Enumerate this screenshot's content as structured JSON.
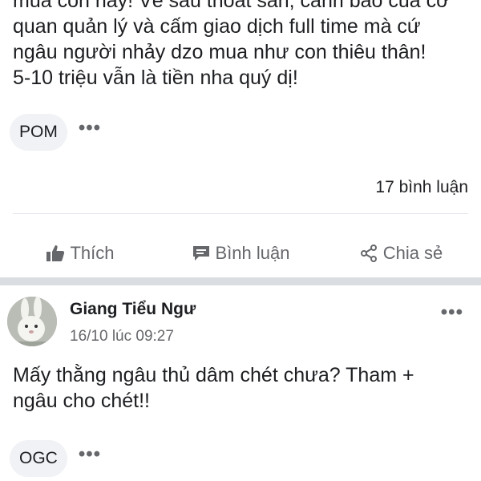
{
  "post1": {
    "text": "mua con này! Về sau thoát sàn, cảnh báo của cơ\nquan quản lý và cấm giao dịch full time mà cứ\nngâu người nhảy dzo mua như con thiêu thân!\n5-10 triệu vẫn là tiền nha quý dị!",
    "tag": "POM",
    "more": "•••",
    "comment_count": "17 bình luận"
  },
  "actions": {
    "like": "Thích",
    "comment": "Bình luận",
    "share": "Chia sẻ"
  },
  "post2": {
    "author": "Giang Tiểu Ngư",
    "time": "16/10 lúc 09:27",
    "text": "Mấy thằng ngâu thủ dâm chét chưa? Tham +\nngâu cho chét!!",
    "tag": "OGC",
    "more": "•••",
    "options": "•••"
  },
  "icons": {
    "like": "thumbs-up-icon",
    "comment": "comment-bubble-icon",
    "share": "share-icon",
    "more": "more-dots-icon"
  },
  "colors": {
    "text": "#1c1e21",
    "secondary_text": "#65676b",
    "chip_bg": "#f0f2f5",
    "divider": "#e4e6eb",
    "section_gap": "#dadde1"
  }
}
